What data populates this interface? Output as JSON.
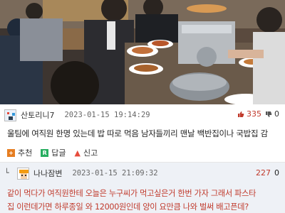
{
  "comment1": {
    "nickname": "산토리니7",
    "date": "2023-01-15 19:14:29",
    "likes": "335",
    "dislikes": "0",
    "body": "울팀에 여직원 한명 있는데 밥 따로 먹음 남자들끼리 맨날 백반집이나 국밥집 감",
    "actions": {
      "recommend": "추천",
      "reply": "답글",
      "report": "신고"
    }
  },
  "comment2": {
    "reply_marker": "└",
    "nickname": "나나잠변",
    "date": "2023-01-15 21:09:32",
    "likes": "227",
    "dislikes": "0",
    "body_line1": "같이 먹다가 여직원한테 오늘은 누구씨가 먹고싶은거 한번 가자 그래서 파스타",
    "body_line2": "집 이런데가면 하루종일 와 12000원인데 양이 요만큼 나와 벌써 배고픈데?"
  },
  "colors": {
    "like_red": "#c0392b",
    "reply_bg": "#eef1f6",
    "recommend_orange": "#e67e22",
    "reply_green": "#27ae60"
  }
}
